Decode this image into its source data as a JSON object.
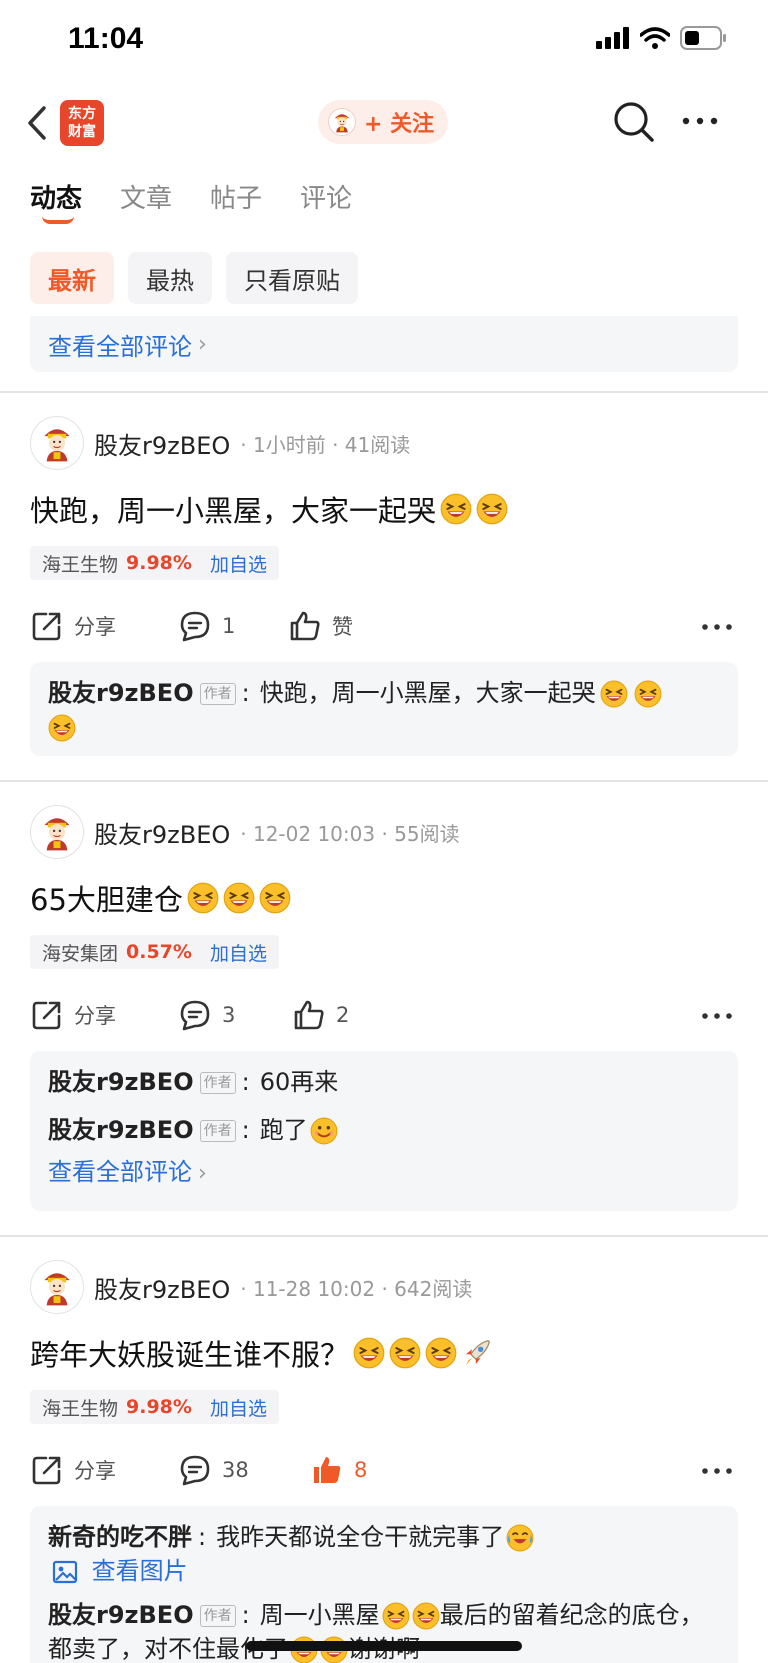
{
  "status_bar": {
    "time": "11:04"
  },
  "nav": {
    "logo_text": "东方财富",
    "follow_label": "+ 关注"
  },
  "tabs": [
    {
      "label": "动态",
      "active": true
    },
    {
      "label": "文章",
      "active": false
    },
    {
      "label": "帖子",
      "active": false
    },
    {
      "label": "评论",
      "active": false
    }
  ],
  "filters": [
    {
      "label": "最新",
      "active": true
    },
    {
      "label": "最热",
      "active": false
    },
    {
      "label": "只看原贴",
      "active": false
    }
  ],
  "view_all_label": "查看全部评论",
  "posts": [
    {
      "author": "股友r9zBEO",
      "time": "1小时前",
      "reads": "41阅读",
      "text": "快跑，周一小黑屋，大家一起哭",
      "stock": {
        "name": "海王生物",
        "change": "9.98%",
        "add_label": "加自选"
      },
      "share_label": "分享",
      "comments": "1",
      "likes_label": "赞",
      "replies": [
        {
          "name": "股友r9zBEO",
          "is_author": true,
          "author_tag": "作者",
          "text": "快跑，周一小黑屋，大家一起哭"
        }
      ]
    },
    {
      "author": "股友r9zBEO",
      "time": "12-02 10:03",
      "reads": "55阅读",
      "text": "65大胆建仓",
      "stock": {
        "name": "海安集团",
        "change": "0.57%",
        "add_label": "加自选"
      },
      "share_label": "分享",
      "comments": "3",
      "likes": "2",
      "replies": [
        {
          "name": "股友r9zBEO",
          "author_tag": "作者",
          "text": "60再来"
        },
        {
          "name": "股友r9zBEO",
          "author_tag": "作者",
          "text": "跑了"
        }
      ],
      "view_all_label": "查看全部评论"
    },
    {
      "author": "股友r9zBEO",
      "time": "11-28 10:02",
      "reads": "642阅读",
      "text": "跨年大妖股诞生谁不服？",
      "stock": {
        "name": "海王生物",
        "change": "9.98%",
        "add_label": "加自选"
      },
      "share_label": "分享",
      "comments": "38",
      "likes": "8",
      "replies": [
        {
          "name": "新奇的吃不胖",
          "text": "我昨天都说全仓干就完事了",
          "image_link": "查看图片"
        },
        {
          "name": "股友r9zBEO",
          "author_tag": "作者",
          "text": "周一小黑屋",
          "text2": "最后的留着纪念的底仓，都卖了，对不住最化了",
          "text3": "谢谢啊"
        }
      ]
    }
  ],
  "colors": {
    "accent": "#f05a28",
    "link": "#2a6fd6",
    "up": "#e8462b"
  }
}
